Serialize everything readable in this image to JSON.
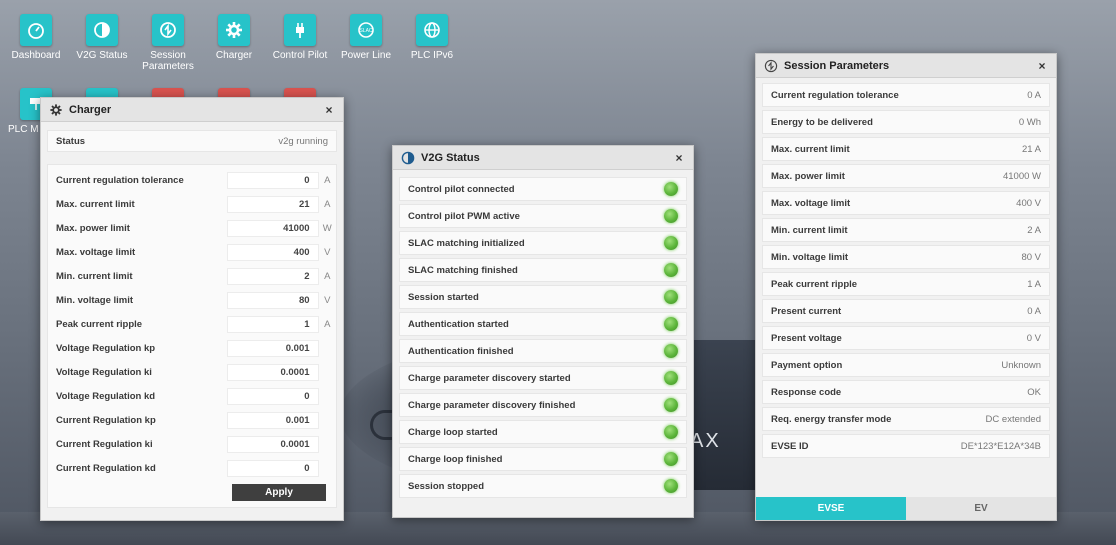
{
  "dock": {
    "items": [
      {
        "label": "Dashboard",
        "icon": "speedometer-icon"
      },
      {
        "label": "V2G Status",
        "icon": "status-circle-icon"
      },
      {
        "label": "Session Parameters",
        "icon": "session-icon"
      },
      {
        "label": "Charger",
        "icon": "gear-icon"
      },
      {
        "label": "Control Pilot",
        "icon": "plug-icon"
      },
      {
        "label": "Power Line",
        "icon": "slac-icon"
      },
      {
        "label": "PLC IPv6",
        "icon": "globe-icon"
      },
      {
        "label": "PLC M",
        "icon": "network-icon"
      }
    ]
  },
  "charger": {
    "title": "Charger",
    "status_label": "Status",
    "status_value": "v2g running",
    "fields": [
      {
        "label": "Current regulation tolerance",
        "value": "0",
        "unit": "A"
      },
      {
        "label": "Max. current limit",
        "value": "21",
        "unit": "A"
      },
      {
        "label": "Max. power limit",
        "value": "41000",
        "unit": "W"
      },
      {
        "label": "Max. voltage limit",
        "value": "400",
        "unit": "V"
      },
      {
        "label": "Min. current limit",
        "value": "2",
        "unit": "A"
      },
      {
        "label": "Min. voltage limit",
        "value": "80",
        "unit": "V"
      },
      {
        "label": "Peak current ripple",
        "value": "1",
        "unit": "A"
      },
      {
        "label": "Voltage Regulation kp",
        "value": "0.001",
        "unit": ""
      },
      {
        "label": "Voltage Regulation ki",
        "value": "0.0001",
        "unit": ""
      },
      {
        "label": "Voltage Regulation kd",
        "value": "0",
        "unit": ""
      },
      {
        "label": "Current Regulation kp",
        "value": "0.001",
        "unit": ""
      },
      {
        "label": "Current Regulation ki",
        "value": "0.0001",
        "unit": ""
      },
      {
        "label": "Current Regulation kd",
        "value": "0",
        "unit": ""
      }
    ],
    "apply_label": "Apply",
    "close": "×"
  },
  "v2g": {
    "title": "V2G Status",
    "close": "×",
    "items": [
      {
        "label": "Control pilot connected"
      },
      {
        "label": "Control pilot PWM active"
      },
      {
        "label": "SLAC matching initialized"
      },
      {
        "label": "SLAC matching finished"
      },
      {
        "label": "Session started"
      },
      {
        "label": "Authentication started"
      },
      {
        "label": "Authentication finished"
      },
      {
        "label": "Charge parameter discovery started"
      },
      {
        "label": "Charge parameter discovery finished"
      },
      {
        "label": "Charge loop started"
      },
      {
        "label": "Charge loop finished"
      },
      {
        "label": "Session stopped"
      }
    ],
    "led_color": "#5cb53a"
  },
  "session": {
    "title": "Session Parameters",
    "close": "×",
    "params": [
      {
        "label": "Current regulation tolerance",
        "value": "0 A"
      },
      {
        "label": "Energy to be delivered",
        "value": "0 Wh"
      },
      {
        "label": "Max. current limit",
        "value": "21 A"
      },
      {
        "label": "Max. power limit",
        "value": "41000 W"
      },
      {
        "label": "Max. voltage limit",
        "value": "400 V"
      },
      {
        "label": "Min. current limit",
        "value": "2 A"
      },
      {
        "label": "Min. voltage limit",
        "value": "80 V"
      },
      {
        "label": "Peak current ripple",
        "value": "1 A"
      },
      {
        "label": "Present current",
        "value": "0 A"
      },
      {
        "label": "Present voltage",
        "value": "0 V"
      },
      {
        "label": "Payment option",
        "value": "Unknown"
      },
      {
        "label": "Response code",
        "value": "OK"
      },
      {
        "label": "Req. energy transfer mode",
        "value": "DC extended"
      },
      {
        "label": "EVSE ID",
        "value": "DE*123*E12A*34B"
      }
    ],
    "tabs": [
      "EVSE",
      "EV"
    ],
    "active_tab": "EVSE"
  },
  "background": {
    "car_text": "AX"
  },
  "colors": {
    "accent": "#27c3c9",
    "led_green": "#5cb53a",
    "apply_button": "#3f3f3f"
  }
}
